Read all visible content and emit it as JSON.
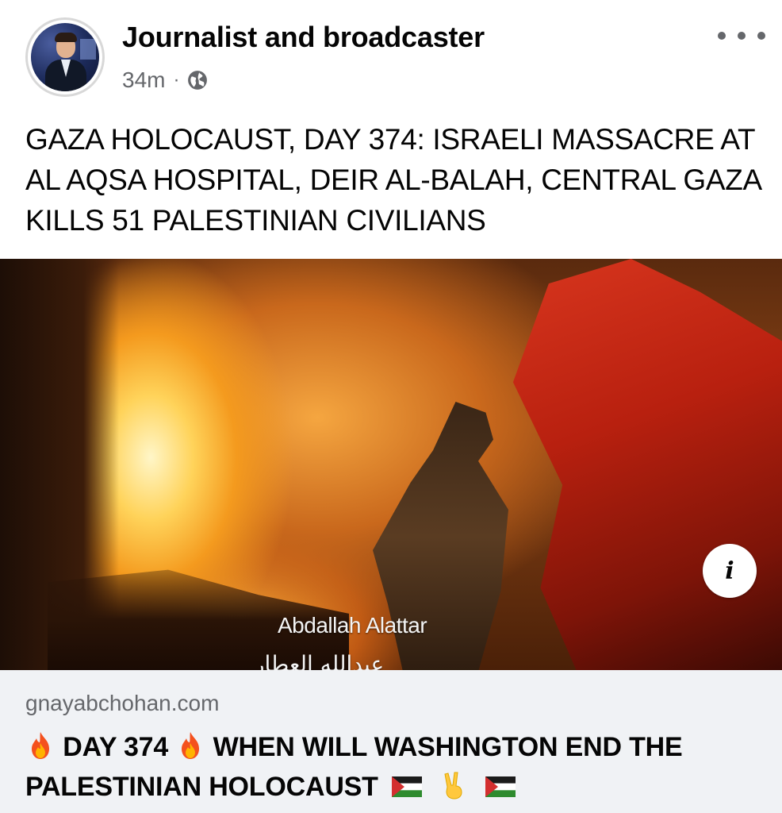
{
  "post": {
    "author": "Journalist and broadcaster",
    "time": "34m",
    "separator": "·",
    "privacy_icon": "globe-icon",
    "more_icon": "more-horizontal-icon",
    "text": "GAZA HOLOCAUST, DAY 374:  ISRAELI MASSACRE AT AL AQSA HOSPITAL, DEIR AL-BALAH, CENTRAL GAZA KILLS 51 PALESTINIAN CIVILIANS"
  },
  "media": {
    "info_icon": "info-icon",
    "caption_en": "Abdallah Alattar",
    "caption_ar": "عبدالله العطار"
  },
  "link": {
    "domain": "gnayabchohan.com",
    "title_part1": "DAY 374",
    "title_part2": "WHEN WILL WASHINGTON END THE PALESTINIAN HOLOCAUST",
    "emojis": [
      "fire-icon",
      "fire-icon",
      "palestine-flag-icon",
      "victory-hand-icon",
      "palestine-flag-icon"
    ]
  },
  "colors": {
    "text_primary": "#050505",
    "text_secondary": "#65676b",
    "link_bg": "#f0f2f5"
  }
}
